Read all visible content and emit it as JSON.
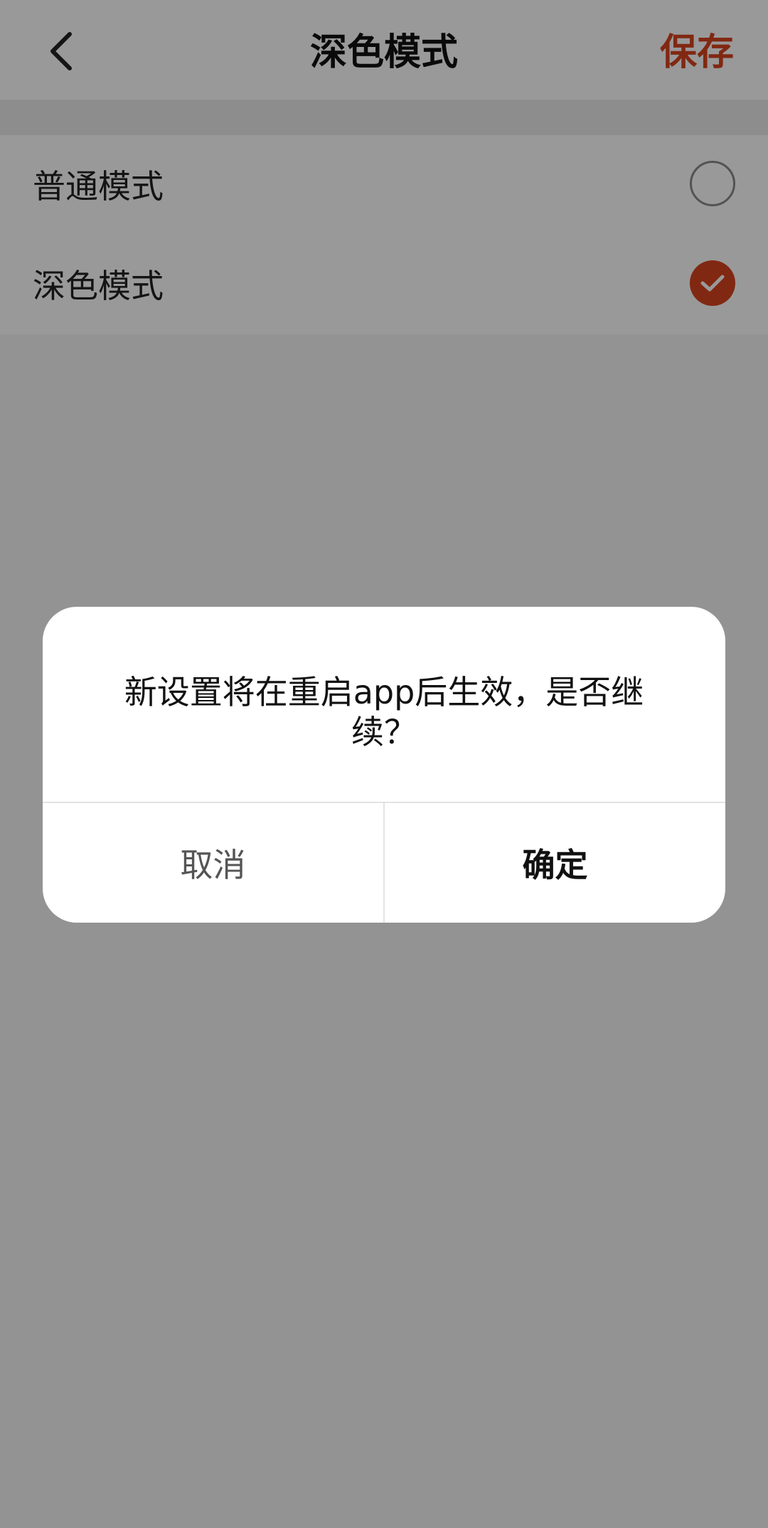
{
  "header": {
    "title": "深色模式",
    "save_label": "保存",
    "back_icon": "chevron-left-icon"
  },
  "options": [
    {
      "label": "普通模式",
      "selected": false
    },
    {
      "label": "深色模式",
      "selected": true
    }
  ],
  "dialog": {
    "message": "新设置将在重启app后生效，是否继续？",
    "cancel_label": "取消",
    "confirm_label": "确定"
  },
  "colors": {
    "accent": "#d8431f"
  }
}
